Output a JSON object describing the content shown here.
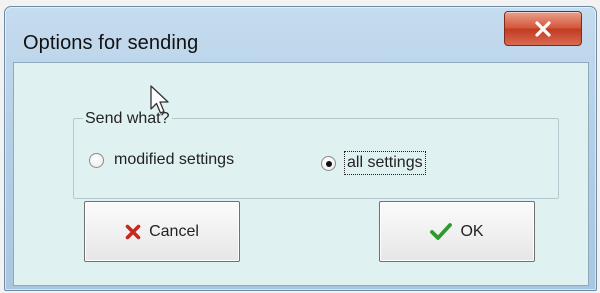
{
  "window": {
    "title": "Options for sending"
  },
  "group": {
    "label": "Send what?"
  },
  "options": [
    {
      "label": "modified settings",
      "selected": false
    },
    {
      "label": "all settings",
      "selected": true
    }
  ],
  "buttons": {
    "cancel_label": "Cancel",
    "ok_label": "OK"
  },
  "icons": {
    "close": "close-icon",
    "cancel": "red-x-icon",
    "ok": "green-check-icon",
    "cursor": "mouse-pointer-icon"
  },
  "colors": {
    "titlebar": "#b4cfe6",
    "client_background": "#e0f1f2",
    "close_button": "#c8452c",
    "cancel_icon": "#c8271e",
    "ok_icon": "#2c9b2c"
  }
}
